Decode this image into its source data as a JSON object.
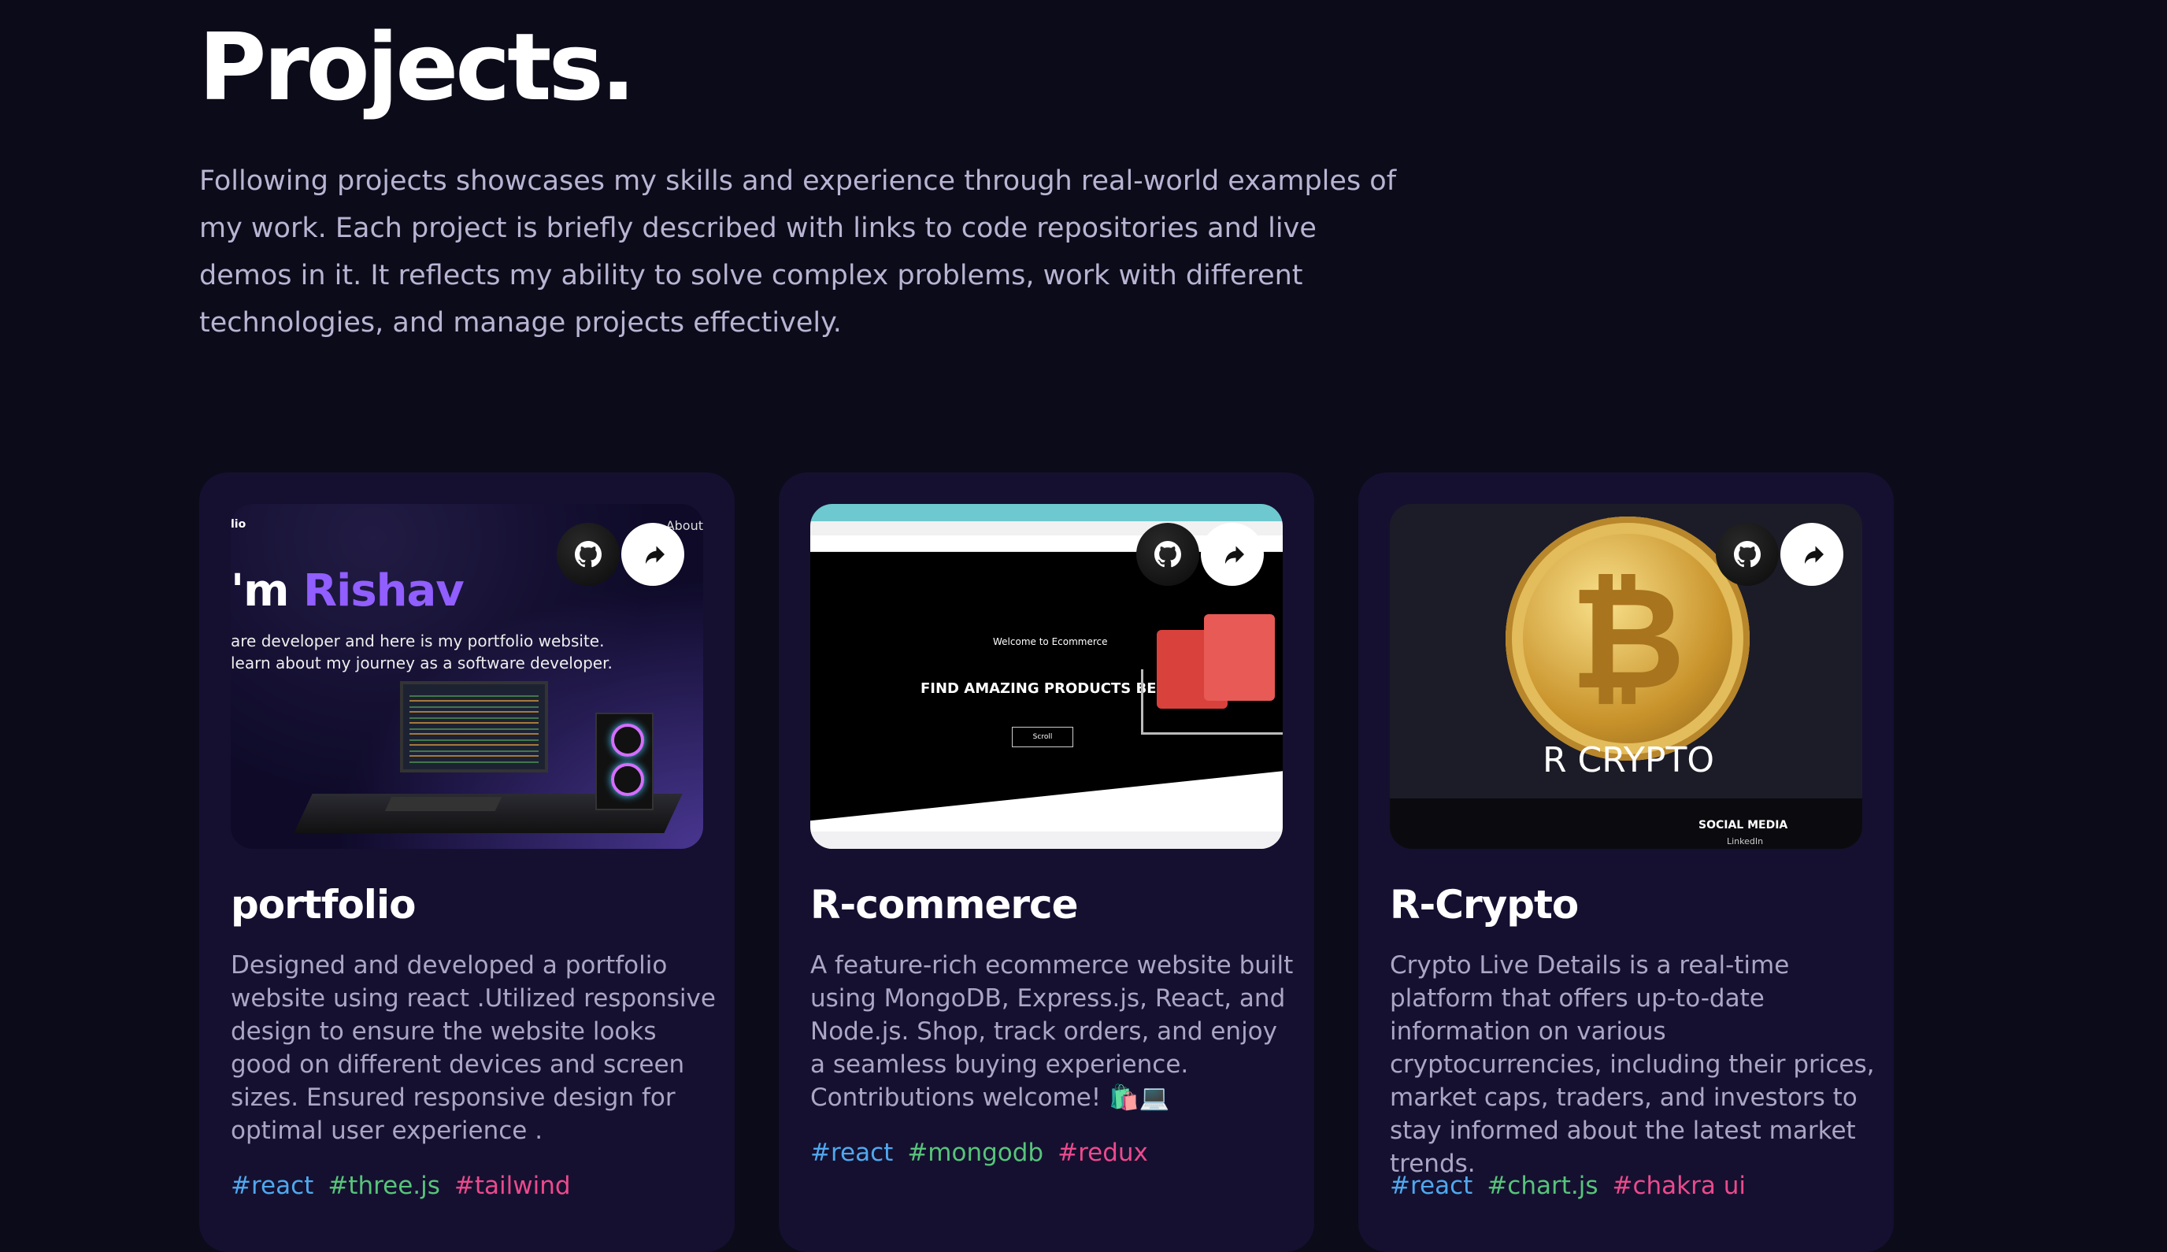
{
  "section": {
    "title": "Projects.",
    "intro": "Following projects showcases my skills and experience through real-world examples of my work. Each project is briefly described with links to code repositories and live demos in it. It reflects my ability to solve complex problems, work with different technologies, and manage projects effectively."
  },
  "projects": [
    {
      "name": "portfolio",
      "description": "Designed and developed a portfolio website using react .Utilized responsive design to ensure the website looks good on different devices and screen sizes. Ensured responsive design for optimal user experience .",
      "tags": [
        "#react",
        "#three.js",
        "#tailwind"
      ],
      "preview": {
        "logo": "lio",
        "nav": "About",
        "heading_prefix": "'m",
        "heading_name": "Rishav",
        "line1": "are developer and here is my portfolio website.",
        "line2": "learn about my journey as a software developer."
      }
    },
    {
      "name": "R-commerce",
      "description": "A feature-rich ecommerce website built using MongoDB, Express.js, React, and Node.js. Shop, track orders, and enjoy a seamless buying experience. Contributions welcome! 🛍️💻",
      "tags": [
        "#react",
        "#mongodb",
        "#redux"
      ],
      "preview": {
        "welcome": "Welcome to Ecommerce",
        "headline": "FIND AMAZING PRODUCTS BELOW",
        "scroll": "Scroll"
      }
    },
    {
      "name": "R-Crypto",
      "description": "Crypto Live Details is a real-time platform that offers up-to-date information on various cryptocurrencies, including their prices, market caps, traders, and investors to stay informed about the latest market trends.",
      "tags": [
        "#react",
        "#chart.js",
        "#chakra ui"
      ],
      "preview": {
        "brand": "R CRYPTO",
        "footer_title": "SOCIAL MEDIA",
        "footer_link": "LinkedIn"
      }
    }
  ],
  "colors": {
    "background": "#0b0b1a",
    "card": "#151030",
    "accent": "#915eff",
    "tag_blue": "#4fa8ee",
    "tag_green": "#57c47a",
    "tag_pink": "#ec4a8c"
  },
  "icons": {
    "source_code": "github-icon",
    "live_demo": "external-link-icon"
  }
}
